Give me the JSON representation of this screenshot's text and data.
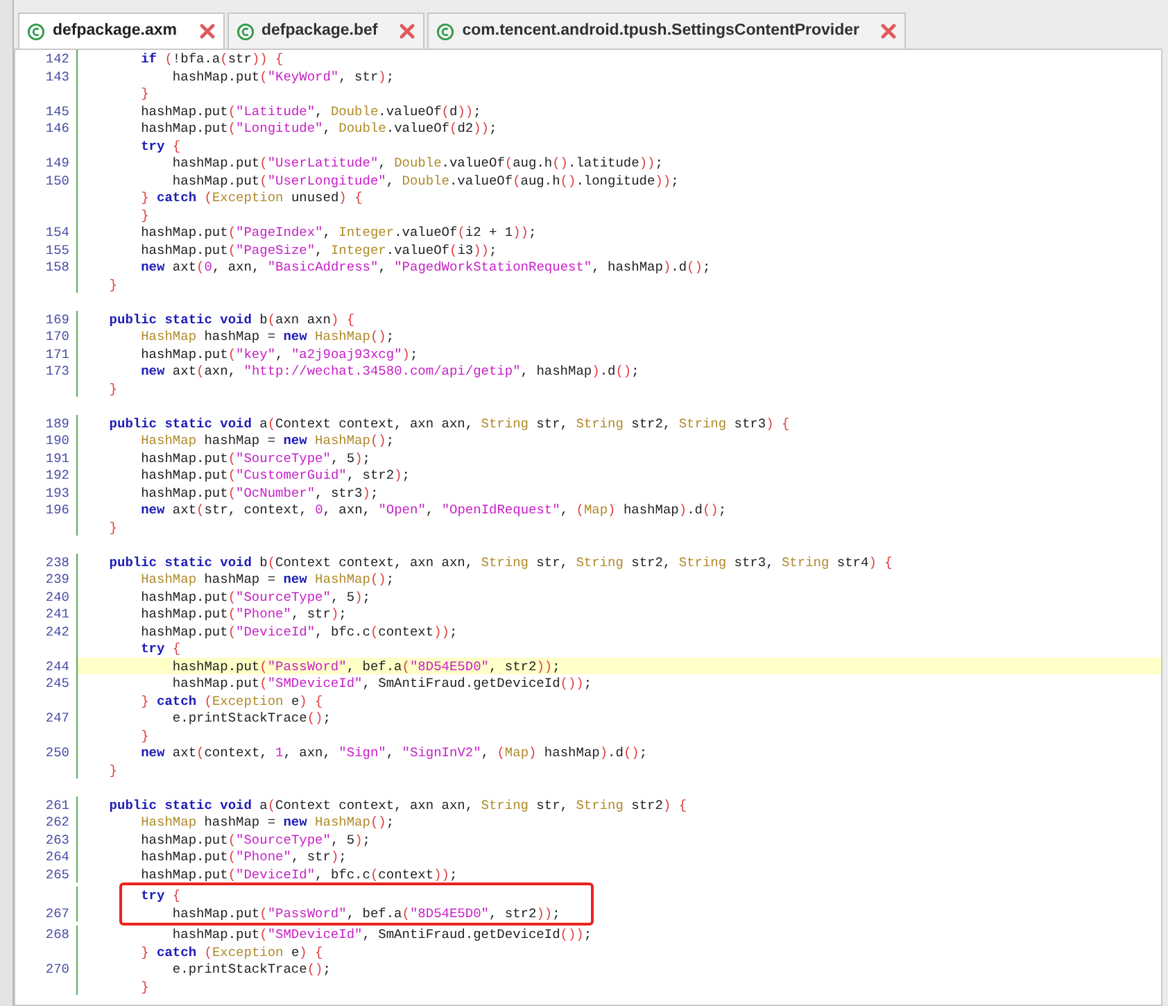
{
  "tabs": [
    {
      "label": "defpackage.axm",
      "selected": true
    },
    {
      "label": "defpackage.bef",
      "selected": false
    },
    {
      "label": "com.tencent.android.tpush.SettingsContentProvider",
      "selected": false
    }
  ],
  "blocks": [
    {
      "lines": [
        {
          "number": "142",
          "highlighted": false,
          "boxed": false,
          "tokens": [
            {
              "kind": "keyword",
              "text": "        if "
            },
            {
              "kind": "paren",
              "text": "("
            },
            {
              "kind": "plain",
              "text": "!bfa.a"
            },
            {
              "kind": "paren",
              "text": "("
            },
            {
              "kind": "plain",
              "text": "str"
            },
            {
              "kind": "paren",
              "text": ")) {"
            }
          ]
        },
        {
          "number": "143",
          "highlighted": false,
          "boxed": false,
          "tokens": [
            {
              "kind": "plain",
              "text": "            hashMap.put"
            },
            {
              "kind": "paren",
              "text": "("
            },
            {
              "kind": "string",
              "text": "\"KeyWord\""
            },
            {
              "kind": "plain",
              "text": ", str"
            },
            {
              "kind": "paren",
              "text": ")"
            },
            {
              "kind": "plain",
              "text": ";"
            }
          ]
        },
        {
          "highlighted": false,
          "boxed": false,
          "tokens": [
            {
              "kind": "paren",
              "text": "        }"
            }
          ]
        },
        {
          "number": "145",
          "highlighted": false,
          "boxed": false,
          "tokens": [
            {
              "kind": "plain",
              "text": "        hashMap.put"
            },
            {
              "kind": "paren",
              "text": "("
            },
            {
              "kind": "string",
              "text": "\"Latitude\""
            },
            {
              "kind": "plain",
              "text": ", "
            },
            {
              "kind": "type",
              "text": "Double"
            },
            {
              "kind": "plain",
              "text": ".valueOf"
            },
            {
              "kind": "paren",
              "text": "("
            },
            {
              "kind": "plain",
              "text": "d"
            },
            {
              "kind": "paren",
              "text": "))"
            },
            {
              "kind": "plain",
              "text": ";"
            }
          ]
        },
        {
          "number": "146",
          "highlighted": false,
          "boxed": false,
          "tokens": [
            {
              "kind": "plain",
              "text": "        hashMap.put"
            },
            {
              "kind": "paren",
              "text": "("
            },
            {
              "kind": "string",
              "text": "\"Longitude\""
            },
            {
              "kind": "plain",
              "text": ", "
            },
            {
              "kind": "type",
              "text": "Double"
            },
            {
              "kind": "plain",
              "text": ".valueOf"
            },
            {
              "kind": "paren",
              "text": "("
            },
            {
              "kind": "plain",
              "text": "d2"
            },
            {
              "kind": "paren",
              "text": "))"
            },
            {
              "kind": "plain",
              "text": ";"
            }
          ]
        },
        {
          "highlighted": false,
          "boxed": false,
          "tokens": [
            {
              "kind": "keyword",
              "text": "        try "
            },
            {
              "kind": "paren",
              "text": "{"
            }
          ]
        },
        {
          "number": "149",
          "highlighted": false,
          "boxed": false,
          "tokens": [
            {
              "kind": "plain",
              "text": "            hashMap.put"
            },
            {
              "kind": "paren",
              "text": "("
            },
            {
              "kind": "string",
              "text": "\"UserLatitude\""
            },
            {
              "kind": "plain",
              "text": ", "
            },
            {
              "kind": "type",
              "text": "Double"
            },
            {
              "kind": "plain",
              "text": ".valueOf"
            },
            {
              "kind": "paren",
              "text": "("
            },
            {
              "kind": "plain",
              "text": "aug.h"
            },
            {
              "kind": "paren",
              "text": "()"
            },
            {
              "kind": "plain",
              "text": ".latitude"
            },
            {
              "kind": "paren",
              "text": "))"
            },
            {
              "kind": "plain",
              "text": ";"
            }
          ]
        },
        {
          "number": "150",
          "highlighted": false,
          "boxed": false,
          "tokens": [
            {
              "kind": "plain",
              "text": "            hashMap.put"
            },
            {
              "kind": "paren",
              "text": "("
            },
            {
              "kind": "string",
              "text": "\"UserLongitude\""
            },
            {
              "kind": "plain",
              "text": ", "
            },
            {
              "kind": "type",
              "text": "Double"
            },
            {
              "kind": "plain",
              "text": ".valueOf"
            },
            {
              "kind": "paren",
              "text": "("
            },
            {
              "kind": "plain",
              "text": "aug.h"
            },
            {
              "kind": "paren",
              "text": "()"
            },
            {
              "kind": "plain",
              "text": ".longitude"
            },
            {
              "kind": "paren",
              "text": "))"
            },
            {
              "kind": "plain",
              "text": ";"
            }
          ]
        },
        {
          "highlighted": false,
          "boxed": false,
          "tokens": [
            {
              "kind": "paren",
              "text": "        } "
            },
            {
              "kind": "keyword",
              "text": "catch "
            },
            {
              "kind": "paren",
              "text": "("
            },
            {
              "kind": "type",
              "text": "Exception"
            },
            {
              "kind": "plain",
              "text": " unused"
            },
            {
              "kind": "paren",
              "text": ") {"
            }
          ]
        },
        {
          "highlighted": false,
          "boxed": false,
          "tokens": [
            {
              "kind": "paren",
              "text": "        }"
            }
          ]
        },
        {
          "number": "154",
          "highlighted": false,
          "boxed": false,
          "tokens": [
            {
              "kind": "plain",
              "text": "        hashMap.put"
            },
            {
              "kind": "paren",
              "text": "("
            },
            {
              "kind": "string",
              "text": "\"PageIndex\""
            },
            {
              "kind": "plain",
              "text": ", "
            },
            {
              "kind": "type",
              "text": "Integer"
            },
            {
              "kind": "plain",
              "text": ".valueOf"
            },
            {
              "kind": "paren",
              "text": "("
            },
            {
              "kind": "plain",
              "text": "i2 + 1"
            },
            {
              "kind": "paren",
              "text": "))"
            },
            {
              "kind": "plain",
              "text": ";"
            }
          ]
        },
        {
          "number": "155",
          "highlighted": false,
          "boxed": false,
          "tokens": [
            {
              "kind": "plain",
              "text": "        hashMap.put"
            },
            {
              "kind": "paren",
              "text": "("
            },
            {
              "kind": "string",
              "text": "\"PageSize\""
            },
            {
              "kind": "plain",
              "text": ", "
            },
            {
              "kind": "type",
              "text": "Integer"
            },
            {
              "kind": "plain",
              "text": ".valueOf"
            },
            {
              "kind": "paren",
              "text": "("
            },
            {
              "kind": "plain",
              "text": "i3"
            },
            {
              "kind": "paren",
              "text": "))"
            },
            {
              "kind": "plain",
              "text": ";"
            }
          ]
        },
        {
          "number": "158",
          "highlighted": false,
          "boxed": false,
          "tokens": [
            {
              "kind": "keyword",
              "text": "        new"
            },
            {
              "kind": "plain",
              "text": " axt"
            },
            {
              "kind": "paren",
              "text": "("
            },
            {
              "kind": "string",
              "text": "0"
            },
            {
              "kind": "plain",
              "text": ", axn, "
            },
            {
              "kind": "string",
              "text": "\"BasicAddress\""
            },
            {
              "kind": "plain",
              "text": ", "
            },
            {
              "kind": "string",
              "text": "\"PagedWorkStationRequest\""
            },
            {
              "kind": "plain",
              "text": ", hashMap"
            },
            {
              "kind": "paren",
              "text": ")"
            },
            {
              "kind": "plain",
              "text": ".d"
            },
            {
              "kind": "paren",
              "text": "()"
            },
            {
              "kind": "plain",
              "text": ";"
            }
          ]
        },
        {
          "highlighted": false,
          "boxed": false,
          "tokens": [
            {
              "kind": "paren",
              "text": "    }"
            }
          ]
        }
      ]
    },
    {
      "lines": [
        {
          "number": "169",
          "highlighted": false,
          "boxed": false,
          "tokens": [
            {
              "kind": "keyword",
              "text": "    public static void"
            },
            {
              "kind": "plain",
              "text": " b"
            },
            {
              "kind": "paren",
              "text": "("
            },
            {
              "kind": "plain",
              "text": "axn axn"
            },
            {
              "kind": "paren",
              "text": ") {"
            }
          ]
        },
        {
          "number": "170",
          "highlighted": false,
          "boxed": false,
          "tokens": [
            {
              "kind": "type",
              "text": "        HashMap"
            },
            {
              "kind": "plain",
              "text": " hashMap = "
            },
            {
              "kind": "keyword",
              "text": "new "
            },
            {
              "kind": "type",
              "text": "HashMap"
            },
            {
              "kind": "paren",
              "text": "()"
            },
            {
              "kind": "plain",
              "text": ";"
            }
          ]
        },
        {
          "number": "171",
          "highlighted": false,
          "boxed": false,
          "tokens": [
            {
              "kind": "plain",
              "text": "        hashMap.put"
            },
            {
              "kind": "paren",
              "text": "("
            },
            {
              "kind": "string",
              "text": "\"key\""
            },
            {
              "kind": "plain",
              "text": ", "
            },
            {
              "kind": "string",
              "text": "\"a2j9oaj93xcg\""
            },
            {
              "kind": "paren",
              "text": ")"
            },
            {
              "kind": "plain",
              "text": ";"
            }
          ]
        },
        {
          "number": "173",
          "highlighted": false,
          "boxed": false,
          "tokens": [
            {
              "kind": "keyword",
              "text": "        new"
            },
            {
              "kind": "plain",
              "text": " axt"
            },
            {
              "kind": "paren",
              "text": "("
            },
            {
              "kind": "plain",
              "text": "axn, "
            },
            {
              "kind": "string",
              "text": "\"http://wechat.34580.com/api/getip\""
            },
            {
              "kind": "plain",
              "text": ", hashMap"
            },
            {
              "kind": "paren",
              "text": ")"
            },
            {
              "kind": "plain",
              "text": ".d"
            },
            {
              "kind": "paren",
              "text": "()"
            },
            {
              "kind": "plain",
              "text": ";"
            }
          ]
        },
        {
          "highlighted": false,
          "boxed": false,
          "tokens": [
            {
              "kind": "paren",
              "text": "    }"
            }
          ]
        }
      ]
    },
    {
      "lines": [
        {
          "number": "189",
          "highlighted": false,
          "boxed": false,
          "tokens": [
            {
              "kind": "keyword",
              "text": "    public static void"
            },
            {
              "kind": "plain",
              "text": " a"
            },
            {
              "kind": "paren",
              "text": "("
            },
            {
              "kind": "plain",
              "text": "Context context, axn axn, "
            },
            {
              "kind": "type",
              "text": "String"
            },
            {
              "kind": "plain",
              "text": " str, "
            },
            {
              "kind": "type",
              "text": "String"
            },
            {
              "kind": "plain",
              "text": " str2, "
            },
            {
              "kind": "type",
              "text": "String"
            },
            {
              "kind": "plain",
              "text": " str3"
            },
            {
              "kind": "paren",
              "text": ") {"
            }
          ]
        },
        {
          "number": "190",
          "highlighted": false,
          "boxed": false,
          "tokens": [
            {
              "kind": "type",
              "text": "        HashMap"
            },
            {
              "kind": "plain",
              "text": " hashMap = "
            },
            {
              "kind": "keyword",
              "text": "new "
            },
            {
              "kind": "type",
              "text": "HashMap"
            },
            {
              "kind": "paren",
              "text": "()"
            },
            {
              "kind": "plain",
              "text": ";"
            }
          ]
        },
        {
          "number": "191",
          "highlighted": false,
          "boxed": false,
          "tokens": [
            {
              "kind": "plain",
              "text": "        hashMap.put"
            },
            {
              "kind": "paren",
              "text": "("
            },
            {
              "kind": "string",
              "text": "\"SourceType\""
            },
            {
              "kind": "plain",
              "text": ", 5"
            },
            {
              "kind": "paren",
              "text": ")"
            },
            {
              "kind": "plain",
              "text": ";"
            }
          ]
        },
        {
          "number": "192",
          "highlighted": false,
          "boxed": false,
          "tokens": [
            {
              "kind": "plain",
              "text": "        hashMap.put"
            },
            {
              "kind": "paren",
              "text": "("
            },
            {
              "kind": "string",
              "text": "\"CustomerGuid\""
            },
            {
              "kind": "plain",
              "text": ", str2"
            },
            {
              "kind": "paren",
              "text": ")"
            },
            {
              "kind": "plain",
              "text": ";"
            }
          ]
        },
        {
          "number": "193",
          "highlighted": false,
          "boxed": false,
          "tokens": [
            {
              "kind": "plain",
              "text": "        hashMap.put"
            },
            {
              "kind": "paren",
              "text": "("
            },
            {
              "kind": "string",
              "text": "\"OcNumber\""
            },
            {
              "kind": "plain",
              "text": ", str3"
            },
            {
              "kind": "paren",
              "text": ")"
            },
            {
              "kind": "plain",
              "text": ";"
            }
          ]
        },
        {
          "number": "196",
          "highlighted": false,
          "boxed": false,
          "tokens": [
            {
              "kind": "keyword",
              "text": "        new"
            },
            {
              "kind": "plain",
              "text": " axt"
            },
            {
              "kind": "paren",
              "text": "("
            },
            {
              "kind": "plain",
              "text": "str, context, "
            },
            {
              "kind": "string",
              "text": "0"
            },
            {
              "kind": "plain",
              "text": ", axn, "
            },
            {
              "kind": "string",
              "text": "\"Open\""
            },
            {
              "kind": "plain",
              "text": ", "
            },
            {
              "kind": "string",
              "text": "\"OpenIdRequest\""
            },
            {
              "kind": "plain",
              "text": ", "
            },
            {
              "kind": "paren",
              "text": "("
            },
            {
              "kind": "type",
              "text": "Map"
            },
            {
              "kind": "paren",
              "text": ")"
            },
            {
              "kind": "plain",
              "text": " hashMap"
            },
            {
              "kind": "paren",
              "text": ")"
            },
            {
              "kind": "plain",
              "text": ".d"
            },
            {
              "kind": "paren",
              "text": "()"
            },
            {
              "kind": "plain",
              "text": ";"
            }
          ]
        },
        {
          "highlighted": false,
          "boxed": false,
          "tokens": [
            {
              "kind": "paren",
              "text": "    }"
            }
          ]
        }
      ]
    },
    {
      "lines": [
        {
          "number": "238",
          "highlighted": false,
          "boxed": false,
          "tokens": [
            {
              "kind": "keyword",
              "text": "    public static void"
            },
            {
              "kind": "plain",
              "text": " b"
            },
            {
              "kind": "paren",
              "text": "("
            },
            {
              "kind": "plain",
              "text": "Context context, axn axn, "
            },
            {
              "kind": "type",
              "text": "String"
            },
            {
              "kind": "plain",
              "text": " str, "
            },
            {
              "kind": "type",
              "text": "String"
            },
            {
              "kind": "plain",
              "text": " str2, "
            },
            {
              "kind": "type",
              "text": "String"
            },
            {
              "kind": "plain",
              "text": " str3, "
            },
            {
              "kind": "type",
              "text": "String"
            },
            {
              "kind": "plain",
              "text": " str4"
            },
            {
              "kind": "paren",
              "text": ") {"
            }
          ]
        },
        {
          "number": "239",
          "highlighted": false,
          "boxed": false,
          "tokens": [
            {
              "kind": "type",
              "text": "        HashMap"
            },
            {
              "kind": "plain",
              "text": " hashMap = "
            },
            {
              "kind": "keyword",
              "text": "new "
            },
            {
              "kind": "type",
              "text": "HashMap"
            },
            {
              "kind": "paren",
              "text": "()"
            },
            {
              "kind": "plain",
              "text": ";"
            }
          ]
        },
        {
          "number": "240",
          "highlighted": false,
          "boxed": false,
          "tokens": [
            {
              "kind": "plain",
              "text": "        hashMap.put"
            },
            {
              "kind": "paren",
              "text": "("
            },
            {
              "kind": "string",
              "text": "\"SourceType\""
            },
            {
              "kind": "plain",
              "text": ", 5"
            },
            {
              "kind": "paren",
              "text": ")"
            },
            {
              "kind": "plain",
              "text": ";"
            }
          ]
        },
        {
          "number": "241",
          "highlighted": false,
          "boxed": false,
          "tokens": [
            {
              "kind": "plain",
              "text": "        hashMap.put"
            },
            {
              "kind": "paren",
              "text": "("
            },
            {
              "kind": "string",
              "text": "\"Phone\""
            },
            {
              "kind": "plain",
              "text": ", str"
            },
            {
              "kind": "paren",
              "text": ")"
            },
            {
              "kind": "plain",
              "text": ";"
            }
          ]
        },
        {
          "number": "242",
          "highlighted": false,
          "boxed": false,
          "tokens": [
            {
              "kind": "plain",
              "text": "        hashMap.put"
            },
            {
              "kind": "paren",
              "text": "("
            },
            {
              "kind": "string",
              "text": "\"DeviceId\""
            },
            {
              "kind": "plain",
              "text": ", bfc.c"
            },
            {
              "kind": "paren",
              "text": "("
            },
            {
              "kind": "plain",
              "text": "context"
            },
            {
              "kind": "paren",
              "text": "))"
            },
            {
              "kind": "plain",
              "text": ";"
            }
          ]
        },
        {
          "highlighted": false,
          "boxed": false,
          "tokens": [
            {
              "kind": "keyword",
              "text": "        try "
            },
            {
              "kind": "paren",
              "text": "{"
            }
          ]
        },
        {
          "number": "244",
          "highlighted": true,
          "boxed": false,
          "tokens": [
            {
              "kind": "plain",
              "text": "            hashMap.put"
            },
            {
              "kind": "paren",
              "text": "("
            },
            {
              "kind": "string",
              "text": "\"PassWord\""
            },
            {
              "kind": "plain",
              "text": ", bef.a"
            },
            {
              "kind": "paren",
              "text": "("
            },
            {
              "kind": "string",
              "text": "\"8D54E5D0\""
            },
            {
              "kind": "plain",
              "text": ", str2"
            },
            {
              "kind": "paren",
              "text": "))"
            },
            {
              "kind": "plain",
              "text": ";"
            }
          ]
        },
        {
          "number": "245",
          "highlighted": false,
          "boxed": false,
          "tokens": [
            {
              "kind": "plain",
              "text": "            hashMap.put"
            },
            {
              "kind": "paren",
              "text": "("
            },
            {
              "kind": "string",
              "text": "\"SMDeviceId\""
            },
            {
              "kind": "plain",
              "text": ", SmAntiFraud.getDeviceId"
            },
            {
              "kind": "paren",
              "text": "())"
            },
            {
              "kind": "plain",
              "text": ";"
            }
          ]
        },
        {
          "highlighted": false,
          "boxed": false,
          "tokens": [
            {
              "kind": "paren",
              "text": "        } "
            },
            {
              "kind": "keyword",
              "text": "catch "
            },
            {
              "kind": "paren",
              "text": "("
            },
            {
              "kind": "type",
              "text": "Exception"
            },
            {
              "kind": "plain",
              "text": " e"
            },
            {
              "kind": "paren",
              "text": ") {"
            }
          ]
        },
        {
          "number": "247",
          "highlighted": false,
          "boxed": false,
          "tokens": [
            {
              "kind": "plain",
              "text": "            e.printStackTrace"
            },
            {
              "kind": "paren",
              "text": "()"
            },
            {
              "kind": "plain",
              "text": ";"
            }
          ]
        },
        {
          "highlighted": false,
          "boxed": false,
          "tokens": [
            {
              "kind": "paren",
              "text": "        }"
            }
          ]
        },
        {
          "number": "250",
          "highlighted": false,
          "boxed": false,
          "tokens": [
            {
              "kind": "keyword",
              "text": "        new"
            },
            {
              "kind": "plain",
              "text": " axt"
            },
            {
              "kind": "paren",
              "text": "("
            },
            {
              "kind": "plain",
              "text": "context, "
            },
            {
              "kind": "string",
              "text": "1"
            },
            {
              "kind": "plain",
              "text": ", axn, "
            },
            {
              "kind": "string",
              "text": "\"Sign\""
            },
            {
              "kind": "plain",
              "text": ", "
            },
            {
              "kind": "string",
              "text": "\"SignInV2\""
            },
            {
              "kind": "plain",
              "text": ", "
            },
            {
              "kind": "paren",
              "text": "("
            },
            {
              "kind": "type",
              "text": "Map"
            },
            {
              "kind": "paren",
              "text": ")"
            },
            {
              "kind": "plain",
              "text": " hashMap"
            },
            {
              "kind": "paren",
              "text": ")"
            },
            {
              "kind": "plain",
              "text": ".d"
            },
            {
              "kind": "paren",
              "text": "()"
            },
            {
              "kind": "plain",
              "text": ";"
            }
          ]
        },
        {
          "highlighted": false,
          "boxed": false,
          "tokens": [
            {
              "kind": "paren",
              "text": "    }"
            }
          ]
        }
      ]
    },
    {
      "lines": [
        {
          "number": "261",
          "highlighted": false,
          "boxed": false,
          "tokens": [
            {
              "kind": "keyword",
              "text": "    public static void"
            },
            {
              "kind": "plain",
              "text": " a"
            },
            {
              "kind": "paren",
              "text": "("
            },
            {
              "kind": "plain",
              "text": "Context context, axn axn, "
            },
            {
              "kind": "type",
              "text": "String"
            },
            {
              "kind": "plain",
              "text": " str, "
            },
            {
              "kind": "type",
              "text": "String"
            },
            {
              "kind": "plain",
              "text": " str2"
            },
            {
              "kind": "paren",
              "text": ") {"
            }
          ]
        },
        {
          "number": "262",
          "highlighted": false,
          "boxed": false,
          "tokens": [
            {
              "kind": "type",
              "text": "        HashMap"
            },
            {
              "kind": "plain",
              "text": " hashMap = "
            },
            {
              "kind": "keyword",
              "text": "new "
            },
            {
              "kind": "type",
              "text": "HashMap"
            },
            {
              "kind": "paren",
              "text": "()"
            },
            {
              "kind": "plain",
              "text": ";"
            }
          ]
        },
        {
          "number": "263",
          "highlighted": false,
          "boxed": false,
          "tokens": [
            {
              "kind": "plain",
              "text": "        hashMap.put"
            },
            {
              "kind": "paren",
              "text": "("
            },
            {
              "kind": "string",
              "text": "\"SourceType\""
            },
            {
              "kind": "plain",
              "text": ", 5"
            },
            {
              "kind": "paren",
              "text": ")"
            },
            {
              "kind": "plain",
              "text": ";"
            }
          ]
        },
        {
          "number": "264",
          "highlighted": false,
          "boxed": false,
          "tokens": [
            {
              "kind": "plain",
              "text": "        hashMap.put"
            },
            {
              "kind": "paren",
              "text": "("
            },
            {
              "kind": "string",
              "text": "\"Phone\""
            },
            {
              "kind": "plain",
              "text": ", str"
            },
            {
              "kind": "paren",
              "text": ")"
            },
            {
              "kind": "plain",
              "text": ";"
            }
          ]
        },
        {
          "number": "265",
          "highlighted": false,
          "boxed": false,
          "tokens": [
            {
              "kind": "plain",
              "text": "        hashMap.put"
            },
            {
              "kind": "paren",
              "text": "("
            },
            {
              "kind": "string",
              "text": "\"DeviceId\""
            },
            {
              "kind": "plain",
              "text": ", bfc.c"
            },
            {
              "kind": "paren",
              "text": "("
            },
            {
              "kind": "plain",
              "text": "context"
            },
            {
              "kind": "paren",
              "text": "))"
            },
            {
              "kind": "plain",
              "text": ";"
            }
          ]
        },
        {
          "highlighted": false,
          "boxed": true,
          "tokens": [
            {
              "kind": "keyword",
              "text": "        try "
            },
            {
              "kind": "paren",
              "text": "{"
            }
          ]
        },
        {
          "number": "267",
          "highlighted": false,
          "boxed": true,
          "tokens": [
            {
              "kind": "plain",
              "text": "            hashMap.put"
            },
            {
              "kind": "paren",
              "text": "("
            },
            {
              "kind": "string",
              "text": "\"PassWord\""
            },
            {
              "kind": "plain",
              "text": ", bef.a"
            },
            {
              "kind": "paren",
              "text": "("
            },
            {
              "kind": "string",
              "text": "\"8D54E5D0\""
            },
            {
              "kind": "plain",
              "text": ", str2"
            },
            {
              "kind": "paren",
              "text": "))"
            },
            {
              "kind": "plain",
              "text": ";"
            }
          ]
        },
        {
          "number": "268",
          "highlighted": false,
          "boxed": false,
          "tokens": [
            {
              "kind": "plain",
              "text": "            hashMap.put"
            },
            {
              "kind": "paren",
              "text": "("
            },
            {
              "kind": "string",
              "text": "\"SMDeviceId\""
            },
            {
              "kind": "plain",
              "text": ", SmAntiFraud.getDeviceId"
            },
            {
              "kind": "paren",
              "text": "())"
            },
            {
              "kind": "plain",
              "text": ";"
            }
          ]
        },
        {
          "highlighted": false,
          "boxed": false,
          "tokens": [
            {
              "kind": "paren",
              "text": "        } "
            },
            {
              "kind": "keyword",
              "text": "catch "
            },
            {
              "kind": "paren",
              "text": "("
            },
            {
              "kind": "type",
              "text": "Exception"
            },
            {
              "kind": "plain",
              "text": " e"
            },
            {
              "kind": "paren",
              "text": ") {"
            }
          ]
        },
        {
          "number": "270",
          "highlighted": false,
          "boxed": false,
          "tokens": [
            {
              "kind": "plain",
              "text": "            e.printStackTrace"
            },
            {
              "kind": "paren",
              "text": "()"
            },
            {
              "kind": "plain",
              "text": ";"
            }
          ]
        },
        {
          "highlighted": false,
          "boxed": false,
          "tokens": [
            {
              "kind": "paren",
              "text": "        }"
            }
          ]
        }
      ]
    }
  ]
}
